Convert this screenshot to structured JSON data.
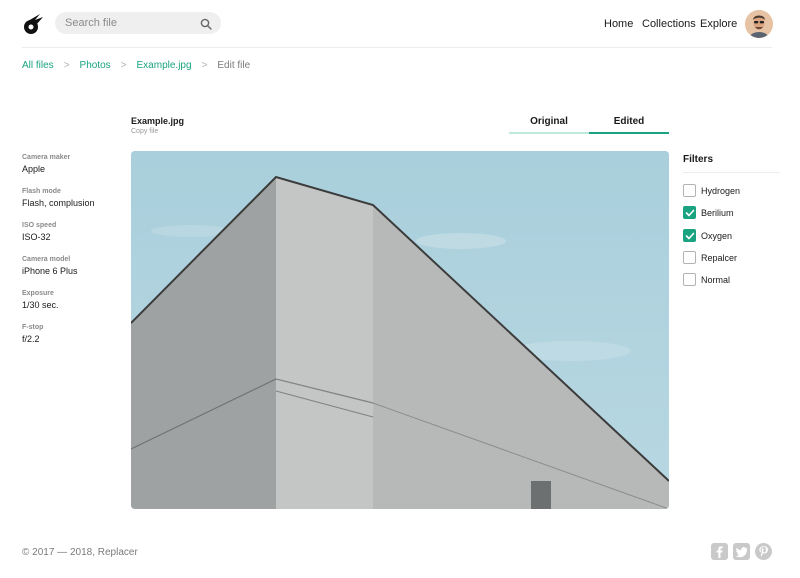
{
  "header": {
    "logo_icon": "comet-logo-icon",
    "search_placeholder": "Search file",
    "nav": {
      "home": "Home",
      "collections": "Collections",
      "explore": "Explore"
    }
  },
  "breadcrumb": {
    "all": "All files",
    "photos": "Photos",
    "file": "Example.jpg",
    "current": "Edit file",
    "separator": ">"
  },
  "file": {
    "name": "Example.jpg",
    "copy_label": "Copy file"
  },
  "tabs": {
    "original": "Original",
    "edited": "Edited",
    "active": "Edited"
  },
  "meta": [
    {
      "label": "Camera maker",
      "value": "Apple"
    },
    {
      "label": "Flash mode",
      "value": "Flash, complusion"
    },
    {
      "label": "ISO speed",
      "value": "ISO-32"
    },
    {
      "label": "Camera model",
      "value": "iPhone 6 Plus"
    },
    {
      "label": "Exposure",
      "value": "1/30 sec."
    },
    {
      "label": "F-stop",
      "value": "f/2.2"
    }
  ],
  "filters": {
    "title": "Filters",
    "items": [
      {
        "label": "Hydrogen",
        "checked": false
      },
      {
        "label": "Berilium",
        "checked": true
      },
      {
        "label": "Oxygen",
        "checked": true
      },
      {
        "label": "Repalcer",
        "checked": false
      },
      {
        "label": "Normal",
        "checked": false
      }
    ]
  },
  "footer": {
    "copyright": "© 2017 — 2018, Replacer"
  },
  "colors": {
    "accent": "#1aa380",
    "sky": "#acd1de",
    "concrete": "#bcbdbd"
  }
}
